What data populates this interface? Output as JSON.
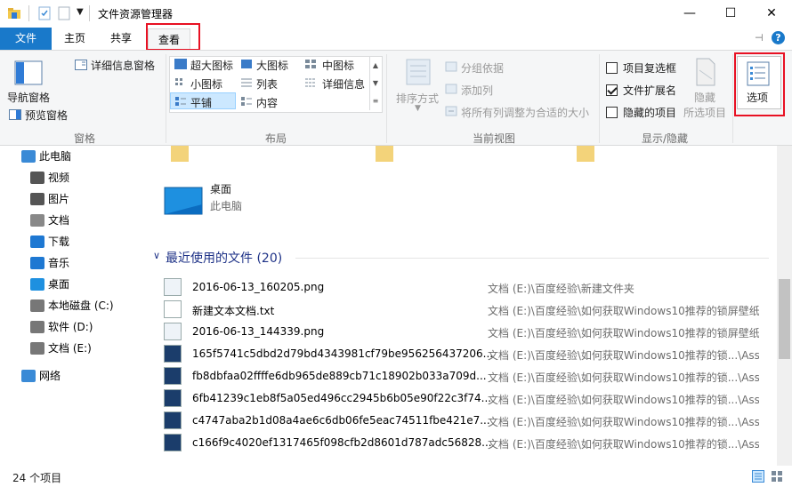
{
  "window": {
    "title": "文件资源管理器",
    "minimize": "—",
    "maximize": "☐",
    "close": "✕"
  },
  "tabs": {
    "file": "文件",
    "home": "主页",
    "share": "共享",
    "view": "查看"
  },
  "ribbon": {
    "pane": {
      "group_label": "窗格",
      "nav_pane": "导航窗格",
      "preview_pane": "预览窗格",
      "details_pane": "详细信息窗格"
    },
    "layout": {
      "group_label": "布局",
      "extra_large": "超大图标",
      "large": "大图标",
      "medium": "中图标",
      "small": "小图标",
      "list": "列表",
      "details": "详细信息",
      "tiles": "平铺",
      "content": "内容"
    },
    "current_view": {
      "group_label": "当前视图",
      "sort_by": "排序方式",
      "group_by": "分组依据",
      "add_columns": "添加列",
      "size_all_columns": "将所有列调整为合适的大小"
    },
    "show_hide": {
      "group_label": "显示/隐藏",
      "item_checkboxes": "项目复选框",
      "file_extensions": "文件扩展名",
      "hidden_items": "隐藏的项目",
      "hide_selected_line1": "隐藏",
      "hide_selected_line2": "所选项目",
      "item_checkboxes_checked": false,
      "file_extensions_checked": true,
      "hidden_items_checked": false
    },
    "options": "选项"
  },
  "nav": {
    "items": [
      {
        "label": "此电脑",
        "icon": "computer-icon"
      },
      {
        "label": "视频",
        "icon": "video-icon"
      },
      {
        "label": "图片",
        "icon": "pictures-icon"
      },
      {
        "label": "文档",
        "icon": "documents-icon"
      },
      {
        "label": "下载",
        "icon": "download-icon"
      },
      {
        "label": "音乐",
        "icon": "music-icon"
      },
      {
        "label": "桌面",
        "icon": "desktop-icon"
      },
      {
        "label": "本地磁盘 (C:)",
        "icon": "drive-icon"
      },
      {
        "label": "软件 (D:)",
        "icon": "drive-icon"
      },
      {
        "label": "文档 (E:)",
        "icon": "drive-icon"
      },
      {
        "label": "网络",
        "icon": "network-icon"
      }
    ]
  },
  "content": {
    "desktop_tile": {
      "name": "桌面",
      "subtitle": "此电脑"
    },
    "recent_header": "最近使用的文件 (20)",
    "files": [
      {
        "name": "2016-06-13_160205.png",
        "location": "文档 (E:)\\百度经验\\新建文件夹",
        "icon": "png-icon"
      },
      {
        "name": "新建文本文档.txt",
        "location": "文档 (E:)\\百度经验\\如何获取Windows10推荐的锁屏壁纸",
        "icon": "txt-icon"
      },
      {
        "name": "2016-06-13_144339.png",
        "location": "文档 (E:)\\百度经验\\如何获取Windows10推荐的锁屏壁纸",
        "icon": "png-icon"
      },
      {
        "name": "165f5741c5dbd2d79bd4343981cf79be956256437206...",
        "location": "文档 (E:)\\百度经验\\如何获取Windows10推荐的锁...\\Assets",
        "icon": "image-icon"
      },
      {
        "name": "fb8dbfaa02ffffe6db965de889cb71c18902b033a709d...",
        "location": "文档 (E:)\\百度经验\\如何获取Windows10推荐的锁...\\Assets",
        "icon": "image-icon"
      },
      {
        "name": "6fb41239c1eb8f5a05ed496cc2945b6b05e90f22c3f74...",
        "location": "文档 (E:)\\百度经验\\如何获取Windows10推荐的锁...\\Assets",
        "icon": "image-icon"
      },
      {
        "name": "c4747aba2b1d08a4ae6c6db06fe5eac74511fbe421e7...",
        "location": "文档 (E:)\\百度经验\\如何获取Windows10推荐的锁...\\Assets",
        "icon": "image-icon"
      },
      {
        "name": "c166f9c4020ef1317465f098cfb2d8601d787adc56828...",
        "location": "文档 (E:)\\百度经验\\如何获取Windows10推荐的锁...\\Assets",
        "icon": "image-icon"
      }
    ]
  },
  "status": {
    "item_count": "24 个项目"
  },
  "colors": {
    "accent": "#1979ca",
    "highlight_red": "#e81123",
    "selected_bg": "#cce8ff"
  }
}
